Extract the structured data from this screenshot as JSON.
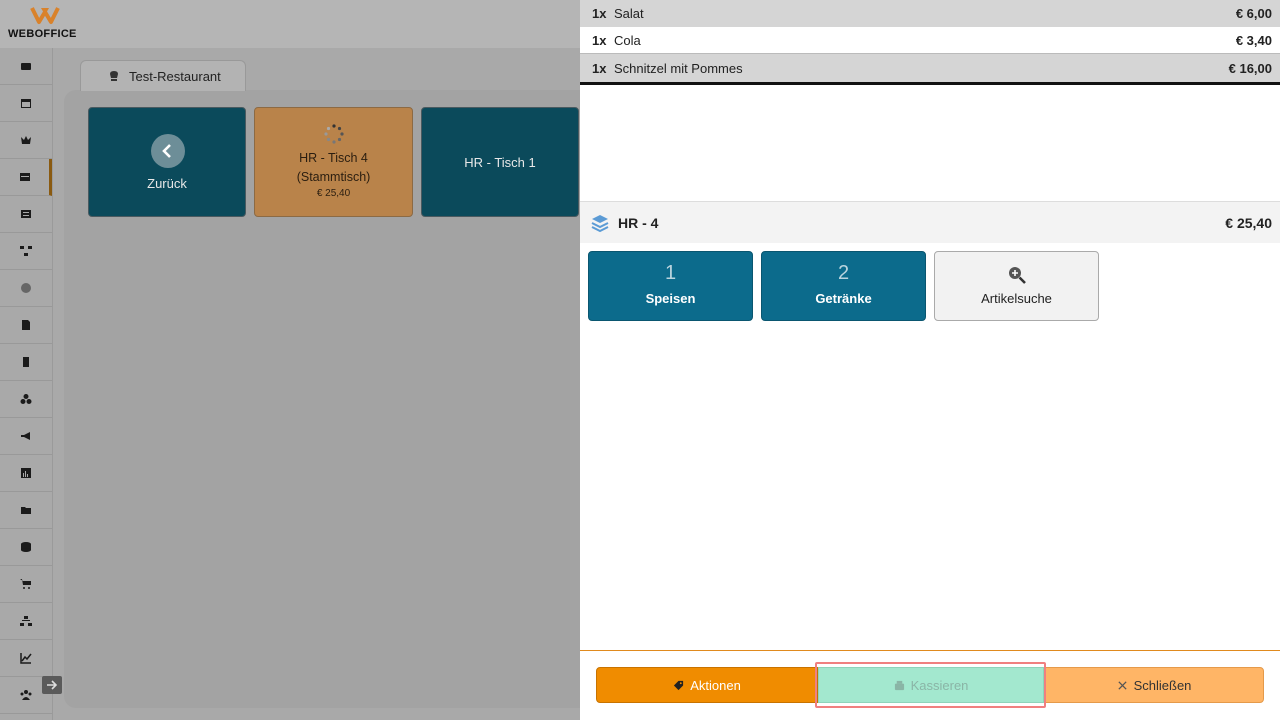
{
  "app": {
    "brand": "WEBOFFICE"
  },
  "sidebar": {
    "items": [
      {
        "icon": "register-icon"
      },
      {
        "icon": "calendar-icon"
      },
      {
        "icon": "crown-icon"
      },
      {
        "icon": "table-icon",
        "active": true
      },
      {
        "icon": "list-icon"
      },
      {
        "icon": "network-icon"
      },
      {
        "icon": "clock-icon"
      },
      {
        "icon": "document-icon"
      },
      {
        "icon": "page-icon"
      },
      {
        "icon": "cubes-icon"
      },
      {
        "icon": "megaphone-icon"
      },
      {
        "icon": "bar-chart-icon"
      },
      {
        "icon": "folder-icon"
      },
      {
        "icon": "database-icon"
      },
      {
        "icon": "cart-icon"
      },
      {
        "icon": "sitemap-icon"
      },
      {
        "icon": "line-chart-icon"
      },
      {
        "icon": "users-icon"
      }
    ]
  },
  "restaurant_tab": {
    "label": "Test-Restaurant"
  },
  "tiles": {
    "back": {
      "label": "Zurück"
    },
    "table4": {
      "line1": "HR - Tisch 4",
      "line2": "(Stammtisch)",
      "amount": "€ 25,40"
    },
    "table1": {
      "label": "HR - Tisch 1"
    }
  },
  "order": {
    "items": [
      {
        "qty": "1x",
        "name": "Salat",
        "price": "€ 6,00"
      },
      {
        "qty": "1x",
        "name": "Cola",
        "price": "€ 3,40"
      },
      {
        "qty": "1x",
        "name": "Schnitzel mit Pommes",
        "price": "€ 16,00"
      }
    ],
    "table_name": "HR - 4",
    "total": "€ 25,40"
  },
  "categories": [
    {
      "number": "1",
      "label": "Speisen"
    },
    {
      "number": "2",
      "label": "Getränke"
    },
    {
      "label": "Artikelsuche"
    }
  ],
  "footer": {
    "actions_label": "Aktionen",
    "checkout_label": "Kassieren",
    "close_label": "Schließen"
  },
  "colors": {
    "teal_tile": "#0b4a5b",
    "category_teal": "#0c6b8c",
    "orange": "#f08c00",
    "checkout_disabled": "#a3e8cf"
  }
}
